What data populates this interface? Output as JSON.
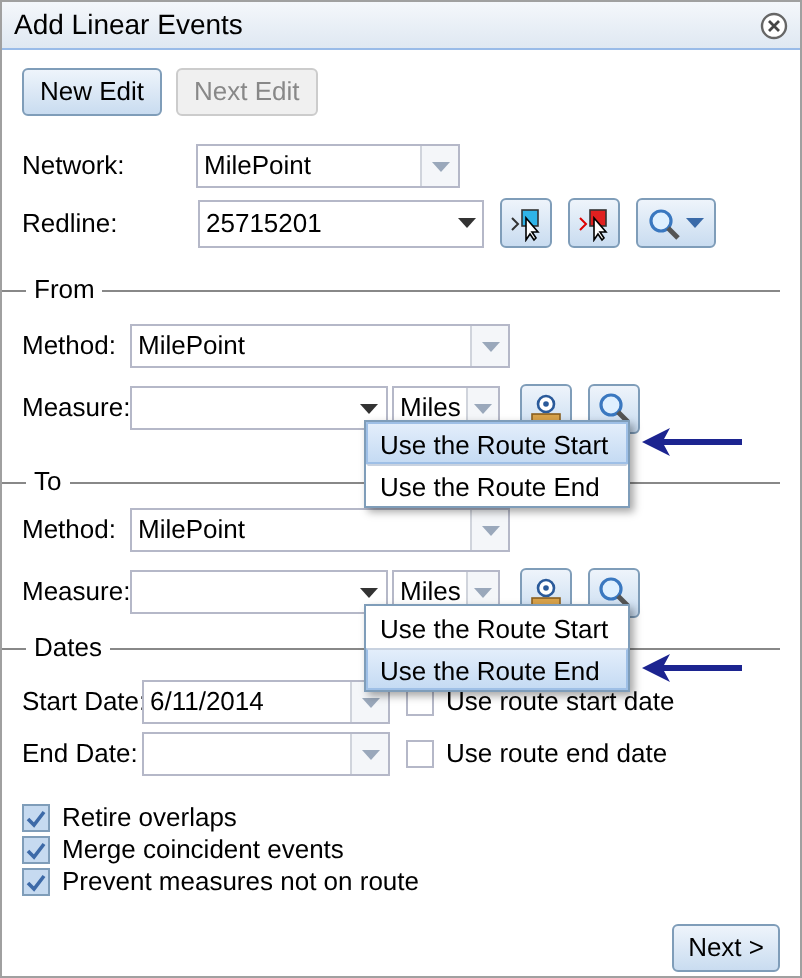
{
  "window": {
    "title": "Add Linear Events"
  },
  "toolbar": [
    {
      "label": "New Edit",
      "disabled": false
    },
    {
      "label": "Next Edit",
      "disabled": true
    }
  ],
  "network": {
    "label": "Network:",
    "value": "MilePoint"
  },
  "redline": {
    "label": "Redline:",
    "value": "25715201"
  },
  "sections": [
    {
      "legend": "From",
      "method_label": "Method:",
      "method": "MilePoint",
      "measure_label": "Measure:",
      "unit": "Miles",
      "menu": [
        {
          "label": "Use the Route Start",
          "selected": true
        },
        {
          "label": "Use the Route End",
          "selected": false
        }
      ]
    },
    {
      "legend": "To",
      "method_label": "Method:",
      "method": "MilePoint",
      "measure_label": "Measure:",
      "unit": "Miles",
      "menu": [
        {
          "label": "Use the Route Start",
          "selected": false
        },
        {
          "label": "Use the Route End",
          "selected": true
        }
      ]
    }
  ],
  "dates": {
    "legend": "Dates",
    "rows": [
      {
        "label": "Start Date:",
        "value": "6/11/2014",
        "option": "Use route start date",
        "checked": false
      },
      {
        "label": "End Date:",
        "option": "Use route end date",
        "checked": false
      }
    ]
  },
  "options": [
    {
      "label": "Retire overlaps",
      "checked": true
    },
    {
      "label": "Merge coincident events",
      "checked": true
    },
    {
      "label": "Prevent measures not on route",
      "checked": true
    }
  ],
  "next_button": "Next >"
}
